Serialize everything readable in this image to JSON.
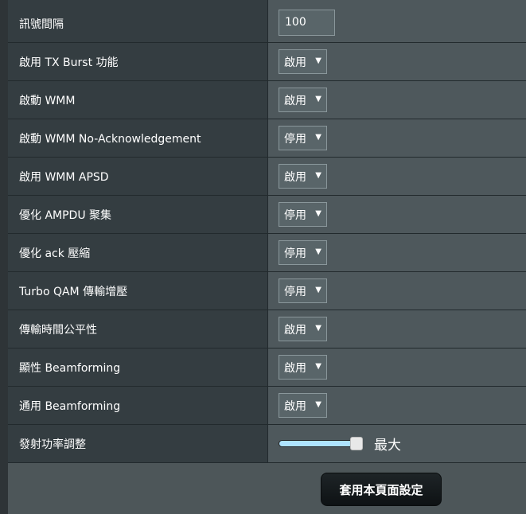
{
  "rows": [
    {
      "label": "訊號間隔",
      "type": "input",
      "value": "100"
    },
    {
      "label": "啟用 TX Burst 功能",
      "type": "select",
      "value": "啟用"
    },
    {
      "label": "啟動 WMM",
      "type": "select",
      "value": "啟用"
    },
    {
      "label": "啟動 WMM No-Acknowledgement",
      "type": "select",
      "value": "停用"
    },
    {
      "label": "啟用 WMM APSD",
      "type": "select",
      "value": "啟用"
    },
    {
      "label": "優化 AMPDU 聚集",
      "type": "select",
      "value": "停用"
    },
    {
      "label": "優化 ack 壓縮",
      "type": "select",
      "value": "停用"
    },
    {
      "label": "Turbo QAM 傳輸增壓",
      "type": "select",
      "value": "停用"
    },
    {
      "label": "傳輸時間公平性",
      "type": "select",
      "value": "啟用"
    },
    {
      "label": "顯性 Beamforming",
      "type": "select",
      "value": "啟用"
    },
    {
      "label": "通用 Beamforming",
      "type": "select",
      "value": "啟用"
    },
    {
      "label": "發射功率調整",
      "type": "slider",
      "value_fraction": 1.0,
      "value_label": "最大"
    }
  ],
  "arrow_glyph": "▼",
  "apply_button_label": "套用本頁面設定",
  "colors": {
    "label_bg": "#343d41",
    "value_bg": "#4e585c",
    "slider_fill": "#aee3ff"
  }
}
